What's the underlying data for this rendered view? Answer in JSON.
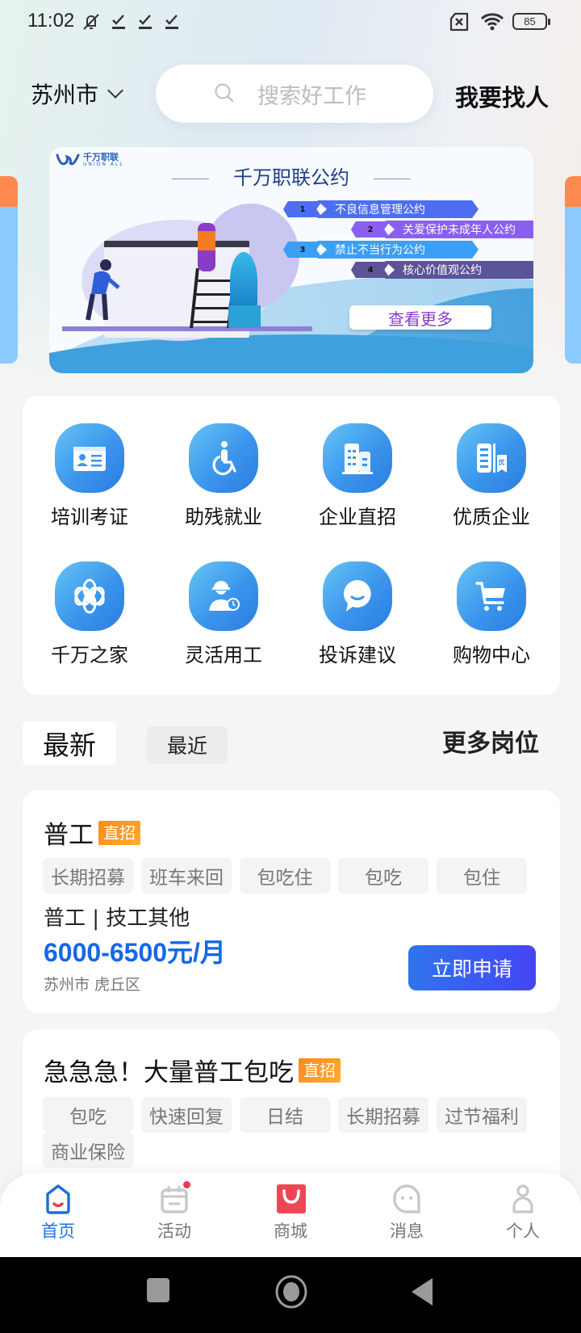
{
  "status_bar": {
    "time": "11:02",
    "icons": [
      "mute-icon",
      "check-icon",
      "check-icon",
      "check-icon"
    ],
    "right_icons": [
      "no-sim-icon",
      "wifi-icon"
    ],
    "battery": "85"
  },
  "header": {
    "city": "苏州市",
    "search_placeholder": "搜索好工作",
    "find_people": "我要找人"
  },
  "banner": {
    "logo_text": "千万职联",
    "logo_sub": "UNION ALL",
    "title": "千万职联公约",
    "items": [
      {
        "num": "1",
        "label": "不良信息管理公约",
        "color": "#4d6ef0"
      },
      {
        "num": "2",
        "label": "关爱保护未成年人公约",
        "color": "#8a5ff0"
      },
      {
        "num": "3",
        "label": "禁止不当行为公约",
        "color": "#3a9ff5"
      },
      {
        "num": "4",
        "label": "核心价值观公约",
        "color": "#5b5496"
      }
    ],
    "more_button": "查看更多"
  },
  "quick_menu": {
    "items": [
      {
        "label": "培训考证",
        "icon": "id-card-icon"
      },
      {
        "label": "助残就业",
        "icon": "wheelchair-icon"
      },
      {
        "label": "企业直招",
        "icon": "buildings-icon"
      },
      {
        "label": "优质企业",
        "icon": "premium-company-icon"
      },
      {
        "label": "千万之家",
        "icon": "knot-icon"
      },
      {
        "label": "灵活用工",
        "icon": "worker-clock-icon"
      },
      {
        "label": "投诉建议",
        "icon": "chat-bubble-icon"
      },
      {
        "label": "购物中心",
        "icon": "shopping-cart-icon"
      }
    ]
  },
  "job_tabs": {
    "tabs": [
      {
        "label": "最新",
        "active": true
      },
      {
        "label": "最近",
        "active": false
      }
    ],
    "more": "更多岗位"
  },
  "jobs": [
    {
      "title": "普工",
      "badge": "直招",
      "tags": [
        "长期招募",
        "班车来回",
        "包吃住",
        "包吃",
        "包住"
      ],
      "category": "普工 | 技工其他",
      "salary": "6000-6500元/月",
      "location": "苏州市 虎丘区",
      "apply": "立即申请"
    },
    {
      "title": "急急急！大量普工包吃",
      "badge": "直招",
      "tags": [
        "包吃",
        "快速回复",
        "日结",
        "长期招募",
        "过节福利",
        "商业保险"
      ]
    }
  ],
  "bottom_nav": {
    "items": [
      {
        "label": "首页",
        "icon": "home-icon",
        "active": true
      },
      {
        "label": "活动",
        "icon": "calendar-icon",
        "active": false,
        "dot": true
      },
      {
        "label": "商城",
        "icon": "shopping-bag-icon",
        "active": false
      },
      {
        "label": "消息",
        "icon": "message-icon",
        "active": false
      },
      {
        "label": "个人",
        "icon": "person-icon",
        "active": false
      }
    ]
  },
  "colors": {
    "accent": "#1467e8",
    "badge": "#ff9420",
    "apply_gradient": [
      "#2f75ec",
      "#4545f5"
    ],
    "icon_gradient": [
      "#66c4f5",
      "#2a7de0"
    ]
  }
}
